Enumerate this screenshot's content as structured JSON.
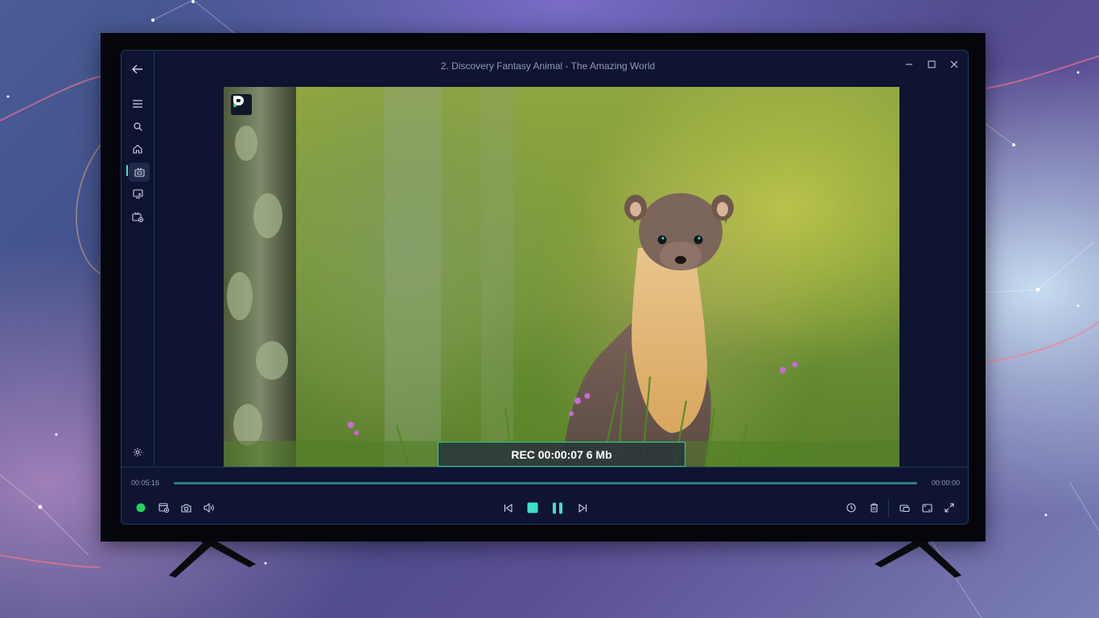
{
  "window": {
    "title": "2. Discovery Fantasy Animal - The Amazing World"
  },
  "sidebar": {
    "items": [
      {
        "name": "back",
        "icon": "arrow-left-icon"
      },
      {
        "name": "menu",
        "icon": "hamburger-icon"
      },
      {
        "name": "search",
        "icon": "search-icon"
      },
      {
        "name": "home",
        "icon": "home-icon"
      },
      {
        "name": "live-tv",
        "icon": "tv-icon",
        "active": true
      },
      {
        "name": "favorites",
        "icon": "star-screen-icon"
      },
      {
        "name": "recordings",
        "icon": "tv-record-icon"
      },
      {
        "name": "settings",
        "icon": "gear-icon"
      }
    ]
  },
  "player": {
    "rec_status": "REC 00:00:07 6 Mb",
    "time_elapsed": "00:05:16",
    "time_total": "00:00:00",
    "progress": 1.0
  },
  "controls": {
    "left": [
      "record-dot-icon",
      "record-schedule-icon",
      "camera-icon",
      "volume-icon"
    ],
    "center": [
      "skip-previous-icon",
      "stop-icon",
      "pause-icon",
      "skip-next-icon"
    ],
    "right": [
      "clock-icon",
      "trash-icon",
      "picture-in-picture-icon",
      "aspect-ratio-icon",
      "fullscreen-icon"
    ]
  },
  "colors": {
    "accent": "#3ee0c7",
    "record": "#22d35a",
    "window_bg": "#0e1432",
    "track": "#2b7f86"
  }
}
